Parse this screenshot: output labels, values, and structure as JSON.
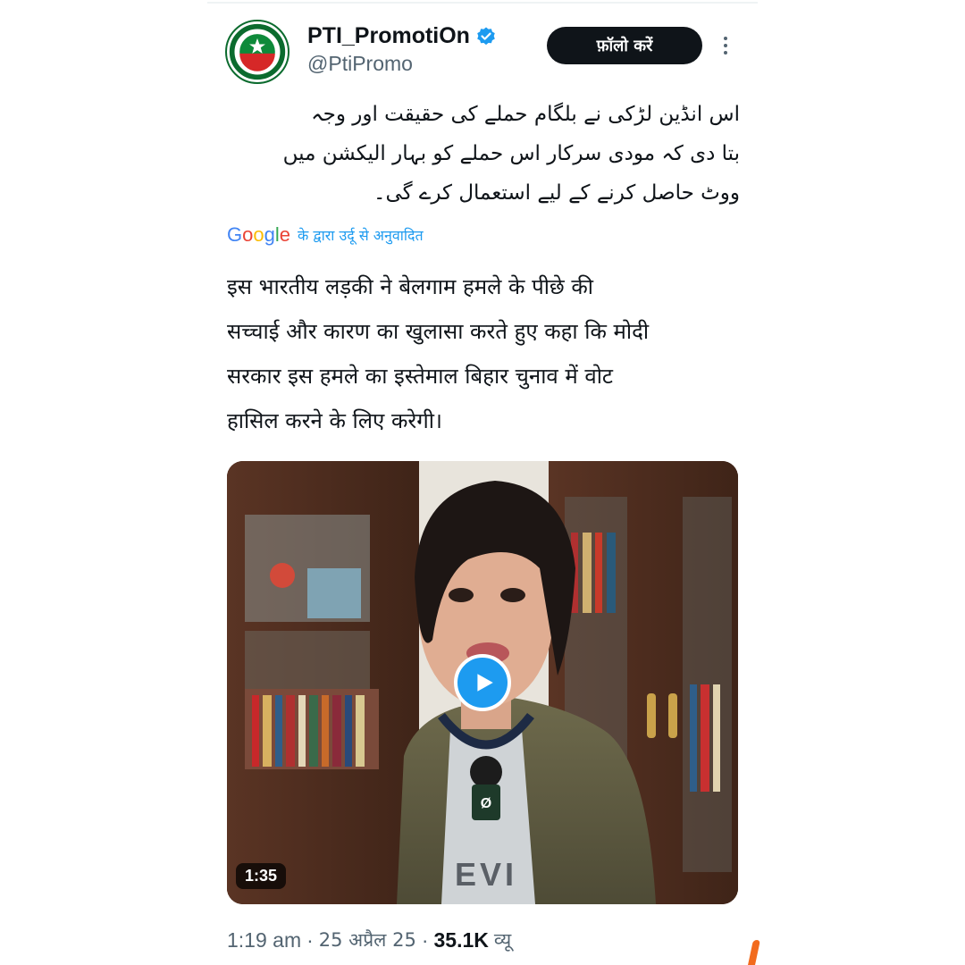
{
  "post": {
    "author": {
      "display_name": "PTI_PromotiOn",
      "handle": "@PtiPromo",
      "verified": true,
      "avatar_icon": "pti-flag-logo-icon"
    },
    "follow_label": "फ़ॉलो करें",
    "urdu_lines": [
      "اس انڈین لڑکی نے بلگام حملے کی حقیقت اور وجہ",
      "بتا دی کہ مودی سرکار اس حملے کو بہار الیکشن میں",
      "ووٹ حاصل کرنے کے لیے استعمال کرے گی۔"
    ],
    "translation": {
      "provider": "Google",
      "label": "के द्वारा उर्दू से अनुवादित"
    },
    "hindi_lines": [
      "इस भारतीय लड़की ने बेलगाम हमले के पीछे की",
      "सच्चाई और कारण का खुलासा करते हुए कहा कि मोदी",
      "सरकार इस हमले का इस्तेमाल बिहार चुनाव में वोट",
      "हासिल करने के लिए करेगी।"
    ],
    "video": {
      "duration": "1:35",
      "play_icon": "play-icon",
      "shirt_text": "EVI"
    },
    "meta": {
      "time": "1:19 am",
      "date": "25 अप्रैल 25",
      "views": "35.1K",
      "views_label": "व्यू",
      "separator": "·"
    }
  },
  "colors": {
    "accent": "#1d9bf0",
    "text_primary": "#0f1419",
    "text_secondary": "#536471",
    "follow_bg": "#0f1419"
  }
}
